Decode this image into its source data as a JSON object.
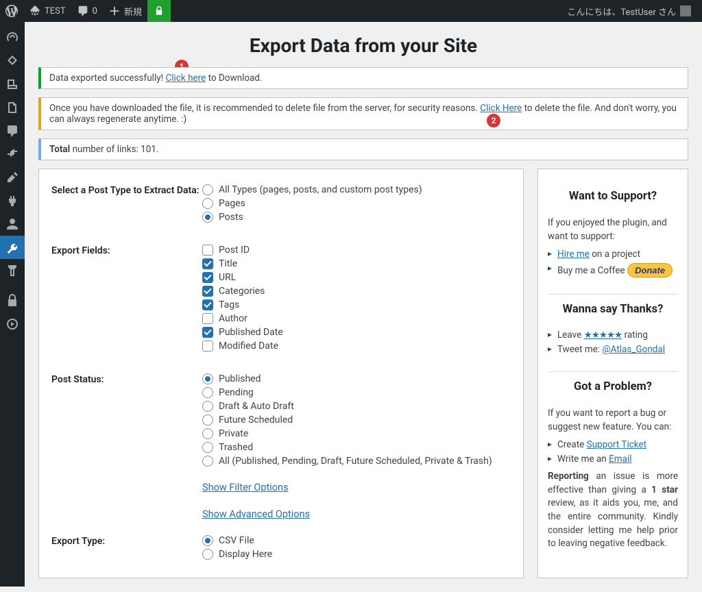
{
  "adminbar": {
    "site_name": "TEST",
    "comments_count": "0",
    "new_label": "新規",
    "greeting": "こんにちは、TestUser さん"
  },
  "page_title": "Export Data from your Site",
  "badges": [
    "1",
    "2"
  ],
  "notices": {
    "success_pre": "Data exported successfully! ",
    "success_link": "Click here",
    "success_post": " to Download.",
    "delete_pre": "Once you have downloaded the file, it is recommended to delete file from the server, for security reasons. ",
    "delete_link": "Click Here",
    "delete_post": " to delete the file. And don't worry, you can always regenerate anytime. :)",
    "total_strong": "Total",
    "total_rest": " number of links: 101."
  },
  "form": {
    "post_type": {
      "label": "Select a Post Type to Extract Data:",
      "options": [
        {
          "label": "All Types (pages, posts, and custom post types)",
          "checked": false
        },
        {
          "label": "Pages",
          "checked": false
        },
        {
          "label": "Posts",
          "checked": true
        }
      ]
    },
    "export_fields": {
      "label": "Export Fields:",
      "options": [
        {
          "label": "Post ID",
          "checked": false
        },
        {
          "label": "Title",
          "checked": true
        },
        {
          "label": "URL",
          "checked": true
        },
        {
          "label": "Categories",
          "checked": true
        },
        {
          "label": "Tags",
          "checked": true
        },
        {
          "label": "Author",
          "checked": false
        },
        {
          "label": "Published Date",
          "checked": true
        },
        {
          "label": "Modified Date",
          "checked": false
        }
      ]
    },
    "post_status": {
      "label": "Post Status:",
      "options": [
        {
          "label": "Published",
          "checked": true
        },
        {
          "label": "Pending",
          "checked": false
        },
        {
          "label": "Draft & Auto Draft",
          "checked": false
        },
        {
          "label": "Future Scheduled",
          "checked": false
        },
        {
          "label": "Private",
          "checked": false
        },
        {
          "label": "Trashed",
          "checked": false
        },
        {
          "label": "All (Published, Pending, Draft, Future Scheduled, Private & Trash)",
          "checked": false
        }
      ]
    },
    "show_filter": "Show Filter Options",
    "show_advanced": "Show Advanced Options",
    "export_type": {
      "label": "Export Type:",
      "options": [
        {
          "label": "CSV File",
          "checked": true
        },
        {
          "label": "Display Here",
          "checked": false
        }
      ]
    }
  },
  "sidebar": {
    "support_title": "Want to Support?",
    "support_intro": "If you enjoyed the plugin, and want to support:",
    "support_items": [
      {
        "pre": "",
        "link": "Hire me",
        "post": " on a project"
      },
      {
        "pre": "Buy me a Coffee ",
        "link": "",
        "post": ""
      }
    ],
    "donate_label": "Donate",
    "thanks_title": "Wanna say Thanks?",
    "thanks_items": [
      {
        "pre": "Leave ",
        "stars": "★★★★★",
        "post": " rating"
      },
      {
        "pre": "Tweet me: ",
        "link": "@Atlas_Gondal",
        "post": ""
      }
    ],
    "problem_title": "Got a Problem?",
    "problem_intro": "If you want to report a bug or suggest new feature. You can:",
    "problem_items": [
      {
        "pre": "Create ",
        "link": "Support Ticket",
        "post": ""
      },
      {
        "pre": "Write me an ",
        "link": "Email",
        "post": ""
      }
    ],
    "reporting_strong": "Reporting",
    "reporting_mid": " an issue is more effective than giving a ",
    "reporting_one": "1 star",
    "reporting_end": " review, as it aids you, me, and the entire community. Kindly consider letting me help prior to leaving negative feedback."
  }
}
